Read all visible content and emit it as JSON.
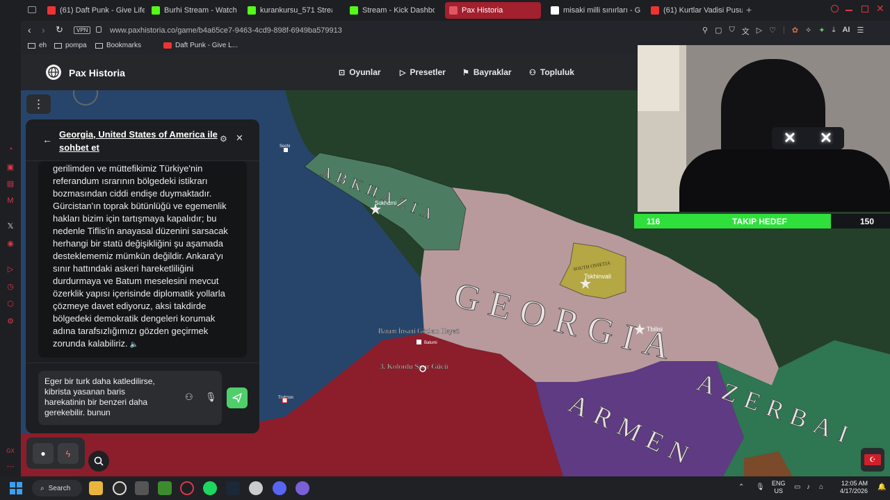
{
  "browser": {
    "tabs": [
      {
        "label": "(61) Daft Punk - Give Life B",
        "color": "#e33"
      },
      {
        "label": "Burhi Stream - Watch Live",
        "color": "#53fc18"
      },
      {
        "label": "kurankursu_571 Stream - W",
        "color": "#53fc18"
      },
      {
        "label": "Stream - Kick Dashboard",
        "color": "#53fc18"
      },
      {
        "label": "Pax Historia",
        "color": "#e25563",
        "active": true
      },
      {
        "label": "misaki milli sınırları - Goog",
        "color": "#ffffff"
      },
      {
        "label": "(61) Kurtlar Vadisi Pusu",
        "color": "#e33"
      }
    ],
    "vpn_label": "VPN",
    "url": "www.paxhistoria.co/game/b4a65ce7-9463-4cd9-898f-6949ba579913",
    "ai_label": "AI",
    "bookmarks": [
      "eh",
      "pompa",
      "Bookmarks",
      "Daft Punk - Give L..."
    ]
  },
  "site": {
    "logo_text": "Pax Historia",
    "nav": [
      "Oyunlar",
      "Presetler",
      "Bayraklar",
      "Topluluk"
    ]
  },
  "chat": {
    "title": "Georgia, United States of America ile sohbet et",
    "message_lines": [
      "gerilimden ve müttefikimiz Türkiye'nin",
      "referandum ısrarının bölgedeki istikrarı",
      "bozmasından ciddi endişe duymaktadır.",
      "Gürcistan'ın toprak bütünlüğü ve egemenlik",
      "hakları bizim için tartışmaya kapalıdır; bu",
      "nedenle Tiflis'in anayasal düzenini sarsacak",
      "herhangi bir statü değişikliğini şu aşamada",
      "desteklememiz mümkün değildir. Ankara'yı",
      "sınır hattındaki askeri hareketliliğini",
      "durdurmaya ve Batum meselesini mevcut",
      "özerklik yapısı içerisinde diplomatik yollarla",
      "çözmeye davet ediyoruz, aksi takdirde",
      "bölgedeki demokratik dengeleri korumak",
      "adına tarafsızlığımızı gözden geçirmek",
      "zorunda kalabiliriz."
    ],
    "input_lines": [
      "Eger bir turk daha katledilirse,",
      "kibrista yasanan baris",
      "harekatinin bir benzeri daha",
      "gerekebilir. bunun"
    ]
  },
  "map": {
    "labels": {
      "abkhazia": "ABKHAZIA",
      "georgia": "GEORGIA",
      "azerbaijan": "AZERBAI",
      "armenia": "ARMEN",
      "south_ossetia": "SOUTH OSSETIA"
    },
    "cities": {
      "sokhumi": "Sokhumi",
      "tskhinvali": "Tskhinvali",
      "tbilisi": "Tbilisi",
      "batumi": "Batumi",
      "sochi": "Sochi",
      "trabzon": "Trabzon"
    },
    "units": {
      "observer": "Batum İnsani Gözlem Heyeti",
      "corps": "3. Kolordu Sınır Gücü"
    },
    "colors": {
      "sea": "#27456b",
      "turkey": "#8c1d2b",
      "georgia": "#b89a9c",
      "abkhazia": "#4c7d62",
      "ossetia": "#b4a744",
      "armenia": "#5e3b82",
      "azerbaijan": "#2f7652",
      "russia": "#24402a"
    }
  },
  "stream": {
    "goal_current": "116",
    "goal_label": "TAKIP HEDEF",
    "goal_target": "150",
    "goal_progress": 0.77
  },
  "taskbar": {
    "search_label": "Search",
    "lang": "ENG",
    "region": "US",
    "time": "12:05 AM",
    "date": "4/17/2026"
  }
}
